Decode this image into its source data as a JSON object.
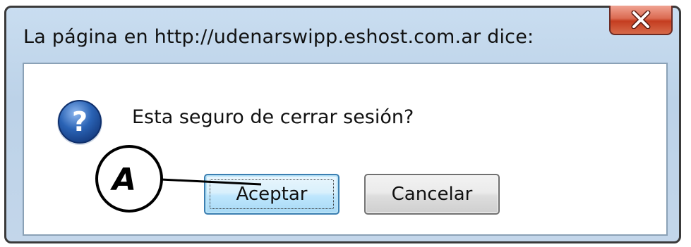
{
  "dialog": {
    "title": "La página en http://udenarswipp.eshost.com.ar dice:",
    "message": "Esta seguro de cerrar sesión?",
    "icon": "question-icon",
    "close_icon": "close-icon",
    "buttons": {
      "accept_label": "Aceptar",
      "cancel_label": "Cancelar"
    }
  },
  "annotation": {
    "label": "A"
  },
  "colors": {
    "frame": "#c3d6ea",
    "close_button": "#c43d20",
    "question_icon": "#2a63b5",
    "accept_border": "#3c7fb1"
  }
}
